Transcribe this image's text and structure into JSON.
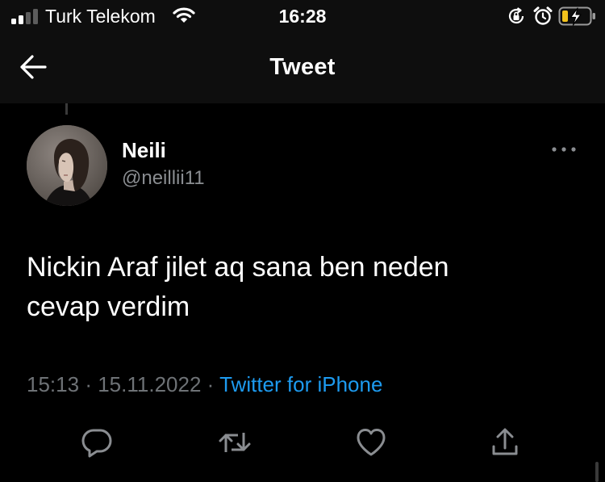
{
  "status_bar": {
    "carrier": "Turk Telekom",
    "time": "16:28",
    "signal_bars_filled": 2,
    "battery_charging": true
  },
  "nav": {
    "title": "Tweet"
  },
  "tweet": {
    "display_name": "Neili",
    "handle": "@neillii11",
    "text_line1": "Nickin Araf jilet aq sana ben neden",
    "text_line2": "cevap verdim",
    "time": "15:13",
    "date": "15.11.2022",
    "separator": "·",
    "source": "Twitter for iPhone"
  },
  "actions": [
    "reply-icon",
    "retweet-icon",
    "like-icon",
    "share-icon"
  ],
  "colors": {
    "background": "#000000",
    "bar": "#0e0e0e",
    "accent": "#1d9bf0",
    "muted": "#6e7276",
    "icon": "#8a8d91"
  }
}
